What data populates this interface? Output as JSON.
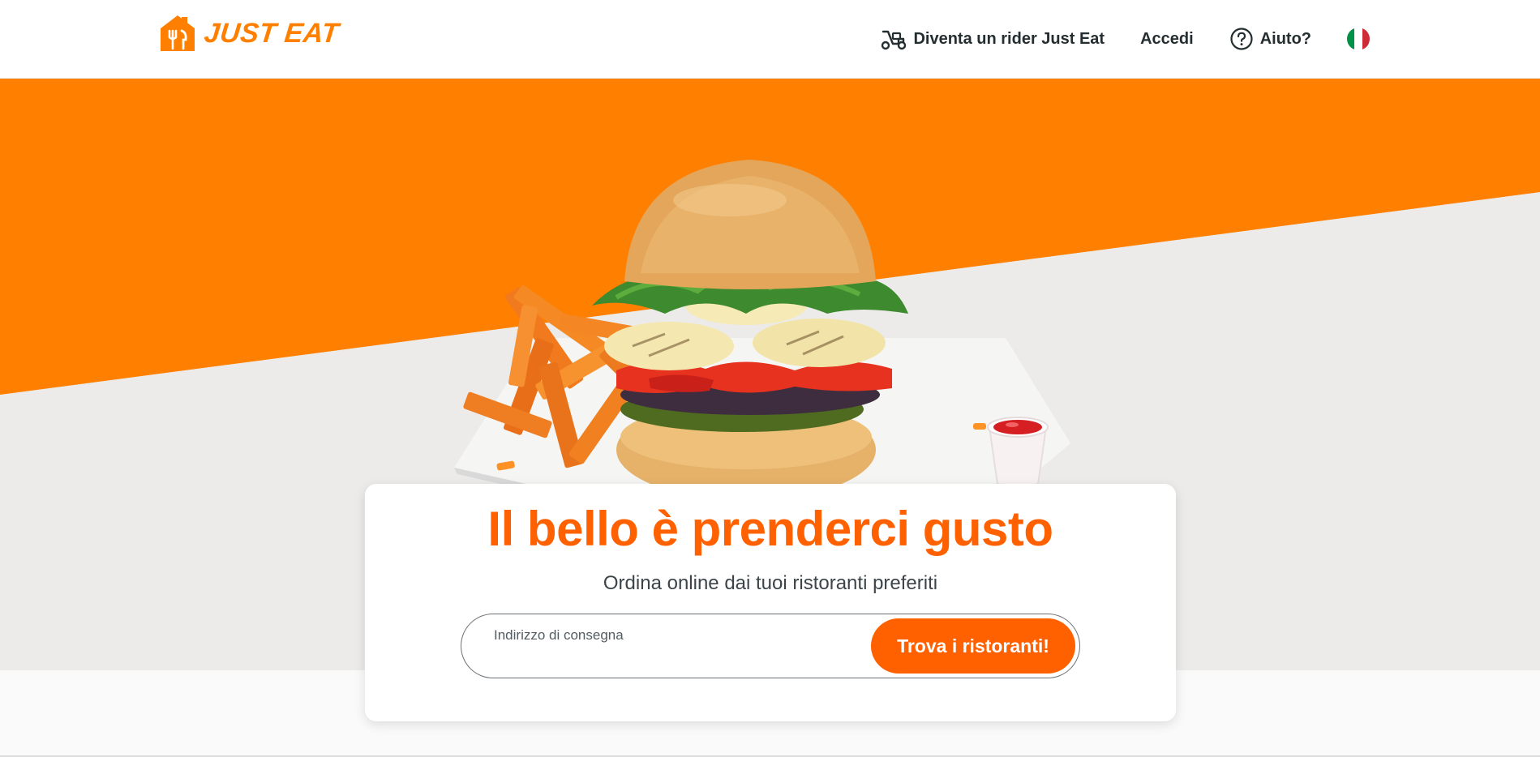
{
  "brand": {
    "name": "JUST EAT",
    "color": "#ff8000"
  },
  "nav": {
    "rider_label": "Diventa un rider Just Eat",
    "login_label": "Accedi",
    "help_label": "Aiuto?",
    "language_icon": "italy-flag-icon"
  },
  "hero": {
    "orange": "#ff7f00",
    "grey": "#ecebe9"
  },
  "card": {
    "headline": "Il bello è prenderci gusto",
    "subheadline": "Ordina online dai tuoi ristoranti preferiti",
    "address_label": "Indirizzo di consegna",
    "address_value": "",
    "search_button": "Trova i ristoranti!",
    "accent": "#ff6000"
  },
  "icons": {
    "rider": "scooter-icon",
    "help": "question-circle-icon",
    "logo": "house-fork-logo-icon"
  }
}
